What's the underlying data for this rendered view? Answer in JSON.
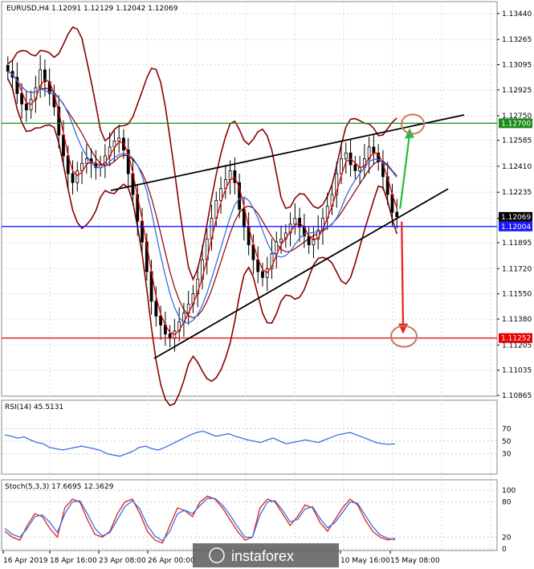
{
  "chart_data": [
    {
      "type": "candlestick",
      "title": "EURUSD,H4  1.12091 1.12129 1.12042 1.12069",
      "y_ticks": [
        "1.13440",
        "1.13265",
        "1.13095",
        "1.12925",
        "1.12750",
        "1.12585",
        "1.12410",
        "1.12235",
        "1.12060",
        "1.11895",
        "1.11720",
        "1.11550",
        "1.11380",
        "1.11205",
        "1.11035",
        "1.10865"
      ],
      "ylim": [
        1.1086,
        1.1352
      ],
      "x_ticks": [
        "16 Apr 2019",
        "18 Apr 16:00",
        "23 Apr 08:00",
        "26 Apr 00:00",
        "10 May 16:00",
        "15 May 08:00"
      ],
      "price_labels": [
        {
          "value": "1.12700",
          "level": 1.127,
          "color": "#1a8a1a"
        },
        {
          "value": "1.12069",
          "level": 1.12069,
          "color": "#000000"
        },
        {
          "value": "1.12004",
          "level": 1.12004,
          "color": "#1a1aff"
        },
        {
          "value": "1.11252",
          "level": 1.11252,
          "color": "#e60000"
        }
      ],
      "horizontal_lines": [
        {
          "level": 1.127,
          "color": "#1a8a1a"
        },
        {
          "level": 1.12004,
          "color": "#1a1aff"
        },
        {
          "level": 1.11252,
          "color": "#e60000"
        }
      ],
      "close_series": [
        1.1305,
        1.1301,
        1.129,
        1.1283,
        1.1279,
        1.1286,
        1.1294,
        1.1306,
        1.1298,
        1.129,
        1.1281,
        1.1262,
        1.1248,
        1.1236,
        1.123,
        1.1238,
        1.1243,
        1.1246,
        1.1243,
        1.124,
        1.1242,
        1.1248,
        1.1254,
        1.1258,
        1.126,
        1.1252,
        1.1236,
        1.1222,
        1.1204,
        1.119,
        1.117,
        1.115,
        1.114,
        1.1134,
        1.1128,
        1.1125,
        1.113,
        1.1136,
        1.1142,
        1.1148,
        1.1155,
        1.1165,
        1.1178,
        1.1192,
        1.1206,
        1.1218,
        1.1226,
        1.1232,
        1.1238,
        1.123,
        1.1212,
        1.12,
        1.1188,
        1.1178,
        1.117,
        1.1166,
        1.1172,
        1.1182,
        1.119,
        1.1192,
        1.1196,
        1.1202,
        1.1206,
        1.12,
        1.1194,
        1.1188,
        1.1192,
        1.1198,
        1.1206,
        1.1214,
        1.1222,
        1.1236,
        1.1246,
        1.125,
        1.1242,
        1.1238,
        1.124,
        1.1246,
        1.1254,
        1.125,
        1.1244,
        1.1234,
        1.1222,
        1.121,
        1.1207
      ],
      "annotations": [
        {
          "type": "arrow",
          "color": "#1fbf3a",
          "direction": "up",
          "target_level": 1.127
        },
        {
          "type": "arrow",
          "color": "#e62020",
          "direction": "down",
          "target_level": 1.11252
        }
      ]
    },
    {
      "type": "line",
      "title": "RSI(14) 45.5131",
      "levels": [
        "70",
        "50",
        "30"
      ],
      "ylim": [
        0,
        100
      ],
      "series": [
        {
          "name": "",
          "color": "#3a6fe0",
          "values": [
            60,
            58,
            55,
            57,
            52,
            48,
            46,
            40,
            38,
            36,
            38,
            40,
            42,
            40,
            38,
            35,
            30,
            28,
            26,
            30,
            34,
            40,
            42,
            38,
            36,
            40,
            45,
            50,
            55,
            60,
            64,
            66,
            62,
            58,
            60,
            62,
            58,
            55,
            52,
            50,
            48,
            52,
            55,
            50,
            46,
            48,
            50,
            52,
            50,
            48,
            52,
            56,
            60,
            62,
            64,
            60,
            56,
            52,
            48,
            46,
            45,
            46
          ]
        }
      ]
    },
    {
      "type": "line",
      "title": "Stoch(5,3,3) 17.6695 12.3629",
      "levels": [
        "100",
        "80",
        "20",
        "0"
      ],
      "ylim": [
        0,
        100
      ],
      "series": [
        {
          "name": "",
          "color": "#e02020",
          "values": [
            30,
            20,
            15,
            40,
            60,
            55,
            35,
            20,
            70,
            85,
            80,
            50,
            25,
            20,
            30,
            60,
            80,
            85,
            60,
            30,
            15,
            10,
            40,
            70,
            65,
            55,
            80,
            90,
            85,
            70,
            50,
            30,
            15,
            20,
            70,
            85,
            80,
            60,
            40,
            55,
            75,
            70,
            45,
            30,
            50,
            70,
            85,
            75,
            50,
            30,
            20,
            15,
            18
          ]
        },
        {
          "name": "",
          "color": "#3a6fe0",
          "values": [
            35,
            25,
            20,
            35,
            55,
            58,
            45,
            28,
            60,
            80,
            82,
            60,
            35,
            22,
            28,
            50,
            72,
            82,
            68,
            40,
            22,
            14,
            30,
            60,
            66,
            60,
            74,
            86,
            86,
            75,
            58,
            38,
            20,
            20,
            58,
            80,
            82,
            66,
            46,
            50,
            68,
            72,
            52,
            36,
            45,
            62,
            80,
            78,
            58,
            38,
            24,
            18,
            16
          ]
        }
      ]
    }
  ],
  "watermark": "instaforex",
  "colors": {
    "bollinger": "#8b0000",
    "ma_fast": "#e00000",
    "ma_slow": "#3a6fe0",
    "trend": "#000000",
    "ellipse": "#c8795c"
  }
}
